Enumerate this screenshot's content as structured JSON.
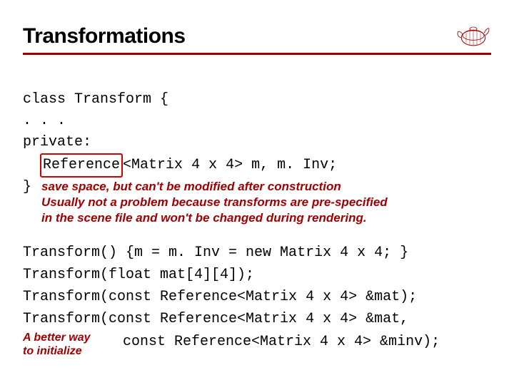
{
  "header": {
    "title": "Transformations"
  },
  "code": {
    "l1": "class Transform {",
    "l2": ". . .",
    "l3": "private:",
    "l4_indent": "  ",
    "l4_boxed": "Reference",
    "l4_rest": "<Matrix 4 x 4> m, m. Inv;",
    "brace": "}"
  },
  "note1": {
    "line1": "save space, but can't be modified after construction",
    "line2": "Usually not a problem because transforms are pre-specified",
    "line3": "in the scene file and won't be changed during rendering."
  },
  "ctors": {
    "c1": "Transform() {m = m. Inv = new Matrix 4 x 4; }",
    "c2": "Transform(float mat[4][4]);",
    "c3": "Transform(const Reference<Matrix 4 x 4> &mat);",
    "c4a": "Transform(const Reference<Matrix 4 x 4> &mat,",
    "c4b": "const Reference<Matrix 4 x 4> &minv);"
  },
  "note2": {
    "line1": "A better way",
    "line2": "to initialize"
  }
}
